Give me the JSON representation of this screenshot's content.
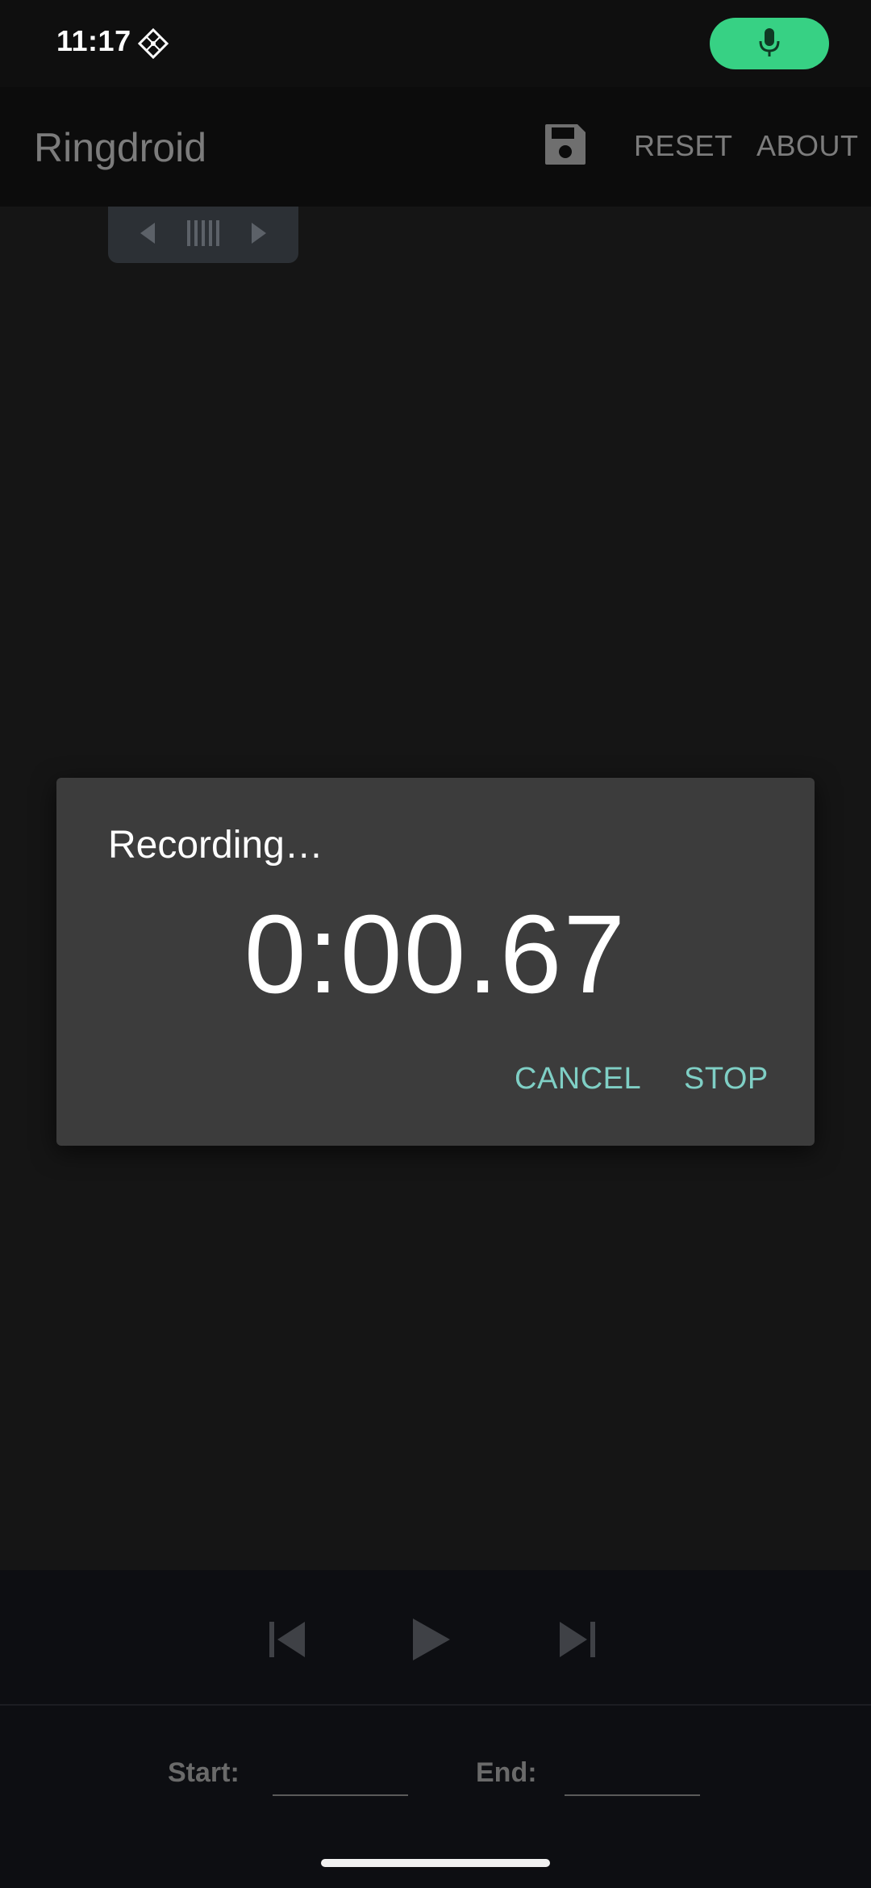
{
  "status_bar": {
    "time": "11:17",
    "indicator_icon": "diamond-grid-icon",
    "mic_icon": "microphone-icon",
    "accent_color": "#37d184"
  },
  "app_bar": {
    "title": "Ringdroid",
    "save_icon": "floppy-save-icon",
    "reset_label": "RESET",
    "about_label": "ABOUT"
  },
  "marker": {
    "left_icon": "triangle-left-icon",
    "grip_icon": "grip-lines-icon",
    "right_icon": "triangle-right-icon"
  },
  "dialog": {
    "title": "Recording…",
    "timer": "0:00.67",
    "cancel_label": "CANCEL",
    "stop_label": "STOP",
    "button_color": "#7fcfc5"
  },
  "transport": {
    "prev_icon": "skip-previous-icon",
    "play_icon": "play-icon",
    "next_icon": "skip-next-icon"
  },
  "range": {
    "start_label": "Start:",
    "end_label": "End:",
    "start_value": "",
    "end_value": ""
  }
}
